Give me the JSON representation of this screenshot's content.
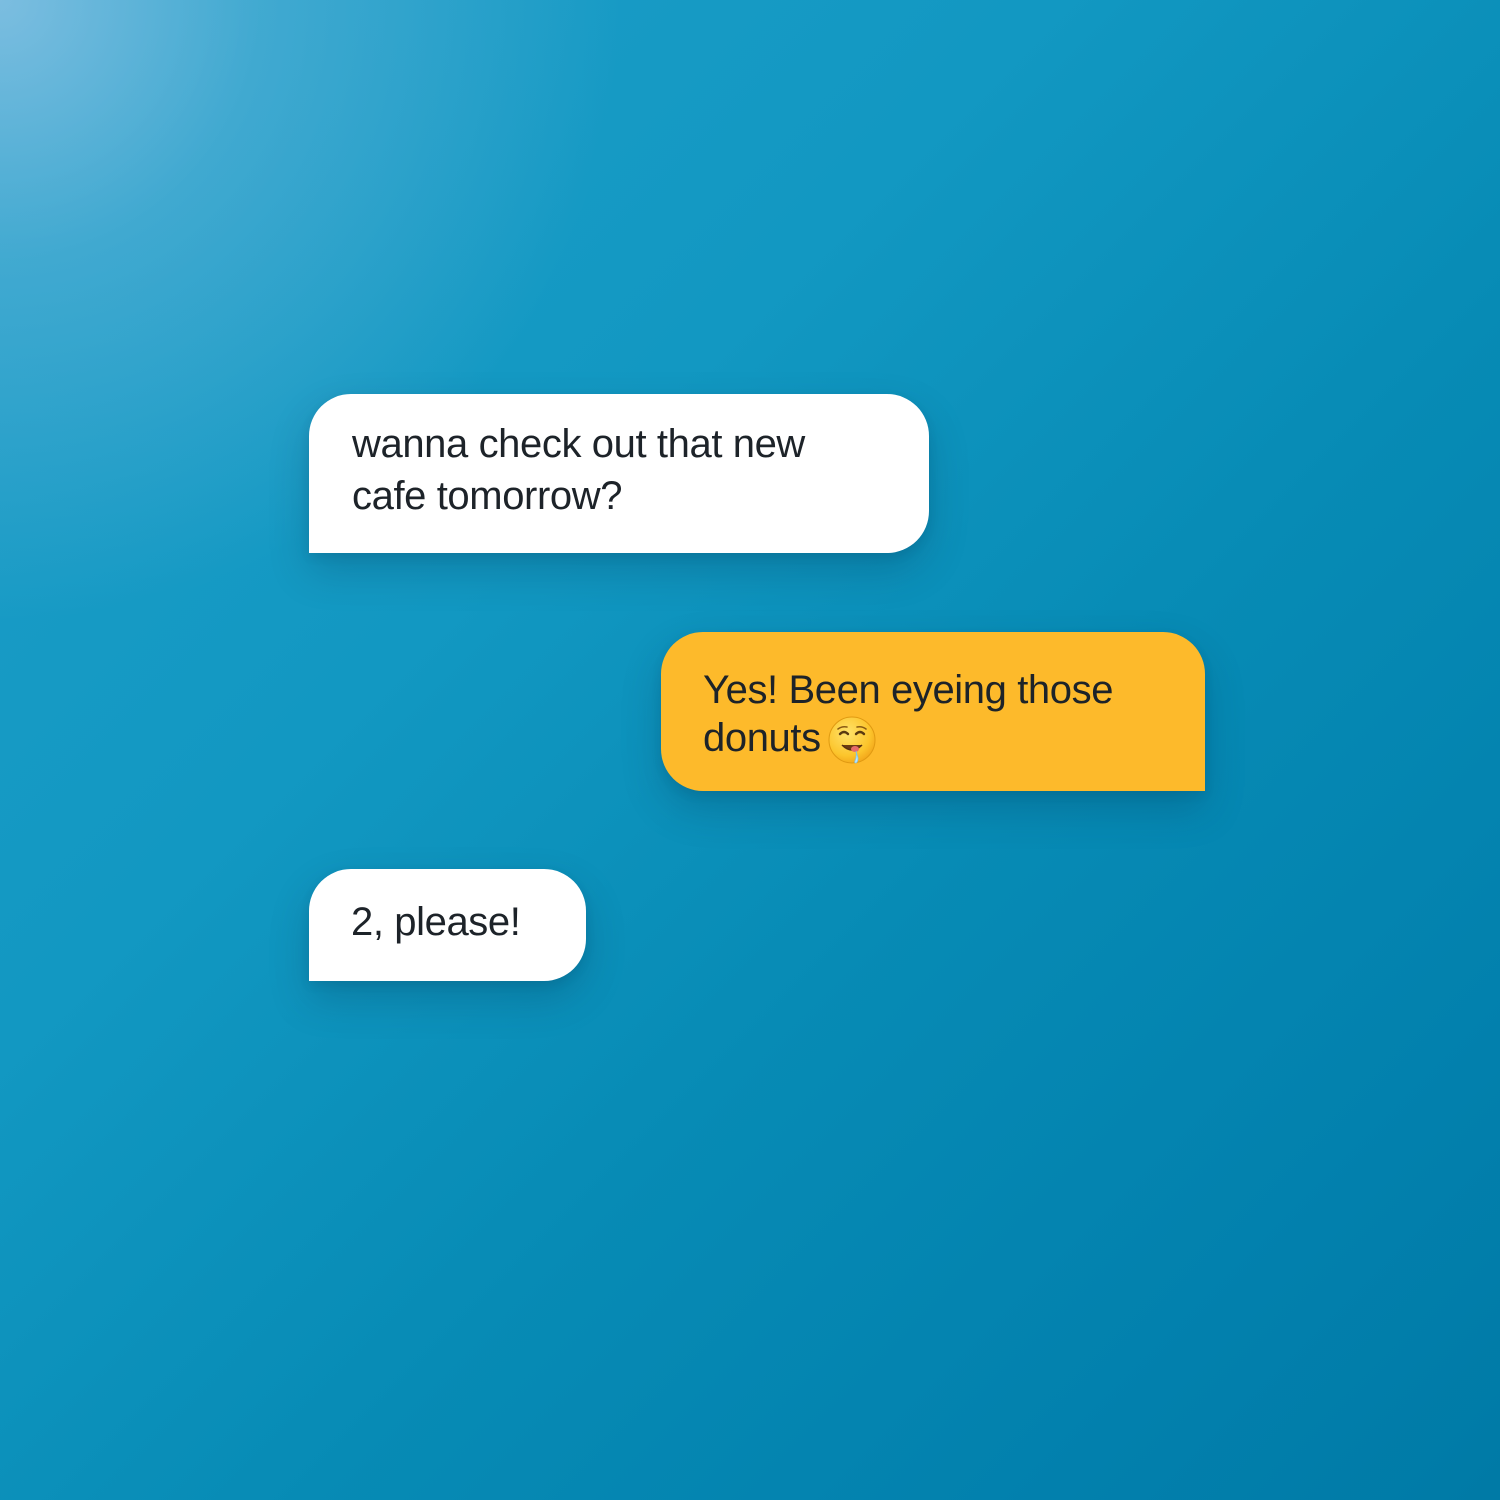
{
  "conversation": {
    "messages": [
      {
        "sender": "incoming",
        "text": "wanna check out that new\ncafe tomorrow?"
      },
      {
        "sender": "outgoing",
        "text": "Yes! Been eyeing those\ndonuts",
        "emoji": "drooling-face-icon"
      },
      {
        "sender": "incoming",
        "text": "2, please!"
      }
    ]
  },
  "colors": {
    "background_start": "#6fb6da",
    "background_end": "#007aa6",
    "incoming_bubble": "#ffffff",
    "outgoing_bubble": "#fdba2b",
    "text": "#1d2329"
  }
}
